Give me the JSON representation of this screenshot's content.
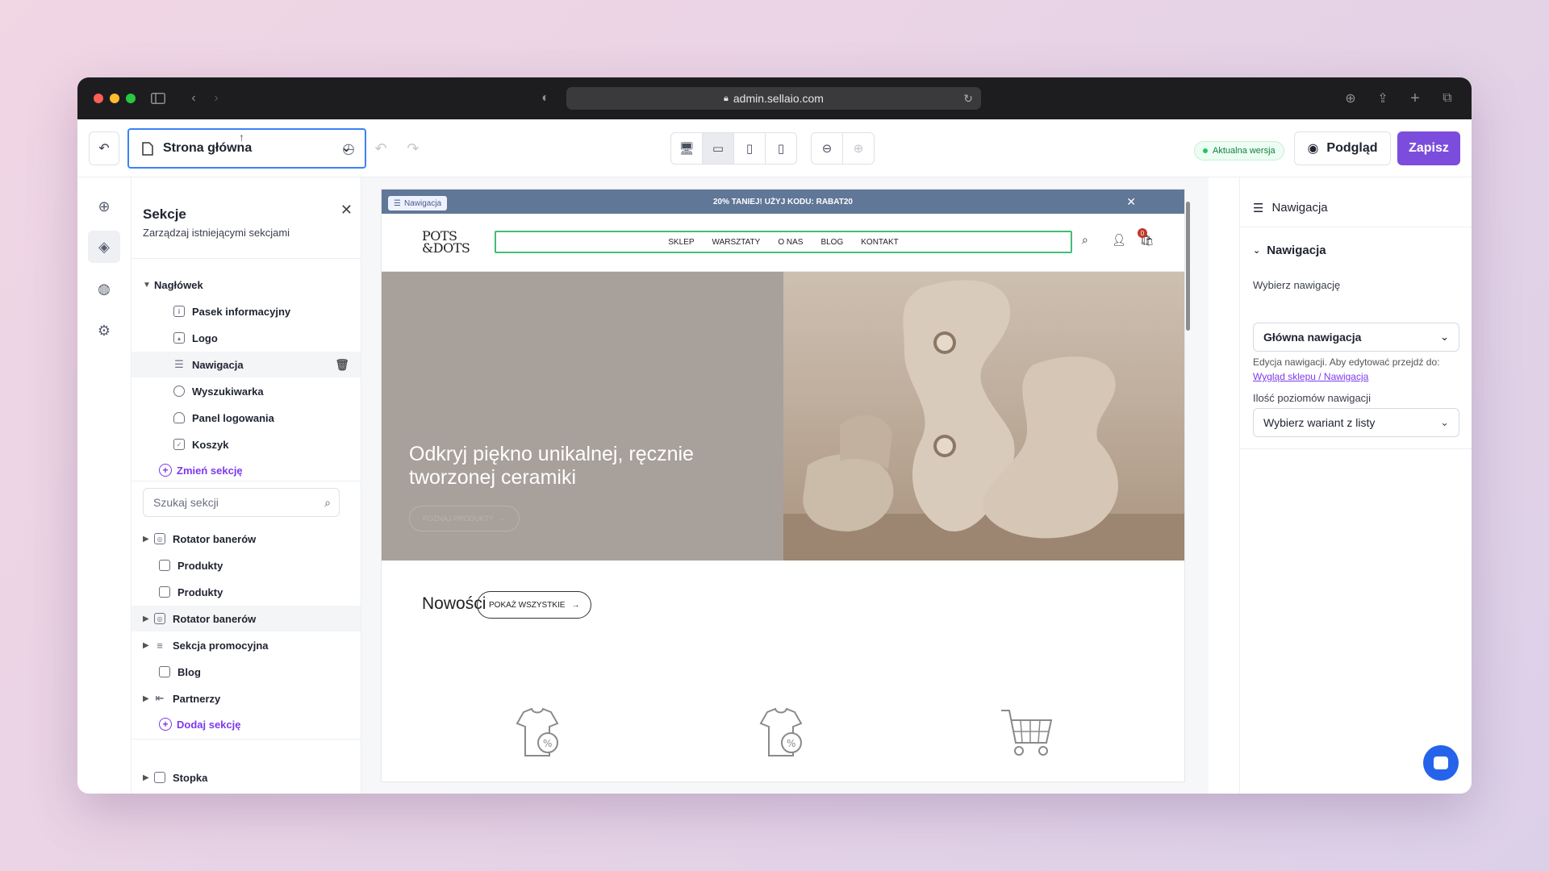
{
  "browser": {
    "url": "admin.sellaio.com"
  },
  "toolbar": {
    "page_select": "Strona główna",
    "step_badge": "1",
    "version_badge": "Aktualna wersja",
    "preview_label": "Podgląd",
    "save_label": "Zapisz",
    "accent_color": "#7c4ddc"
  },
  "sections_panel": {
    "title": "Sekcje",
    "subtitle": "Zarządzaj istniejącymi sekcjami",
    "header_group": "Nagłówek",
    "header_items": [
      "Pasek informacyjny",
      "Logo",
      "Nawigacja",
      "Wyszukiwarka",
      "Panel logowania",
      "Koszyk"
    ],
    "change_section": "Zmień sekcję",
    "search_placeholder": "Szukaj sekcji",
    "body_items": [
      "Rotator banerów",
      "Produkty",
      "Produkty",
      "Rotator banerów",
      "Sekcja promocyjna",
      "Blog",
      "Partnerzy"
    ],
    "add_section": "Dodaj sekcję",
    "footer_item": "Stopka"
  },
  "site": {
    "nav_tag": "Nawigacja",
    "promo": "20% TANIEJ! UŻYJ KODU: RABAT20",
    "logo_line1": "POTS",
    "logo_line2": "&DOTS",
    "menu": [
      "SKLEP",
      "WARSZTATY",
      "O NAS",
      "BLOG",
      "KONTAKT"
    ],
    "cart_count": "0",
    "hero_title": "Odkryj piękno unikalnej, ręcznie tworzonej ceramiki",
    "hero_button": "POZNAJ PRODUKTY",
    "news_title": "Nowości",
    "news_button": "POKAŻ WSZYSTKIE"
  },
  "props_panel": {
    "header": "Nawigacja",
    "section": "Nawigacja",
    "choose_label": "Wybierz nawigację",
    "choose_value": "Główna nawigacja",
    "help_text": "Edycja nawigacji. Aby edytować przejdź do:",
    "help_link": "Wygląd sklepu / Nawigacja",
    "levels_label": "Ilość poziomów nawigacji",
    "levels_value": "Wybierz wariant z listy"
  }
}
